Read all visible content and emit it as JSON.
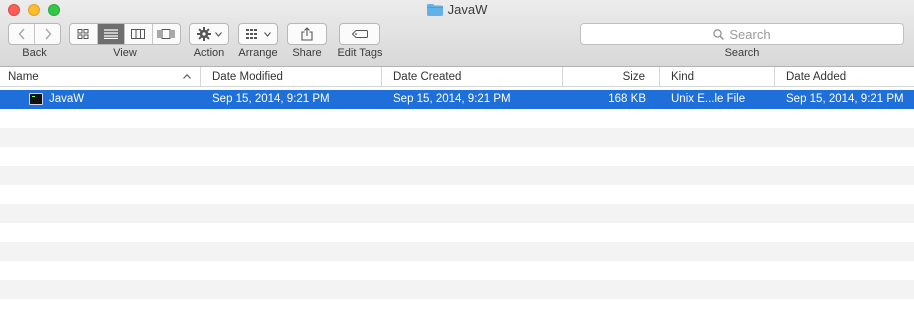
{
  "window": {
    "title": "JavaW"
  },
  "icons": {
    "folder": "folder-icon",
    "back": "chevron-left-icon",
    "forward": "chevron-right-icon",
    "icon_view": "icon-view-icon",
    "list_view": "list-view-icon",
    "column_view": "column-view-icon",
    "coverflow_view": "coverflow-view-icon",
    "action": "gear-icon",
    "arrange": "grid-arrange-icon",
    "share": "share-icon",
    "edit_tags": "tag-icon",
    "search": "magnifier-icon",
    "file": "executable-icon"
  },
  "toolbar": {
    "back_label": "Back",
    "view_label": "View",
    "action_label": "Action",
    "arrange_label": "Arrange",
    "share_label": "Share",
    "edit_tags_label": "Edit Tags",
    "search_label": "Search",
    "search_placeholder": "Search"
  },
  "columns": {
    "name": "Name",
    "date_modified": "Date Modified",
    "date_created": "Date Created",
    "size": "Size",
    "kind": "Kind",
    "date_added": "Date Added"
  },
  "files": [
    {
      "name": "JavaW",
      "date_modified": "Sep 15, 2014, 9:21 PM",
      "date_created": "Sep 15, 2014, 9:21 PM",
      "size": "168 KB",
      "kind": "Unix E...le File",
      "date_added": "Sep 15, 2014, 9:21 PM"
    }
  ],
  "colors": {
    "selection": "#1e6fd9",
    "folder": "#62b1e8",
    "stripe": "#f3f3f3"
  }
}
